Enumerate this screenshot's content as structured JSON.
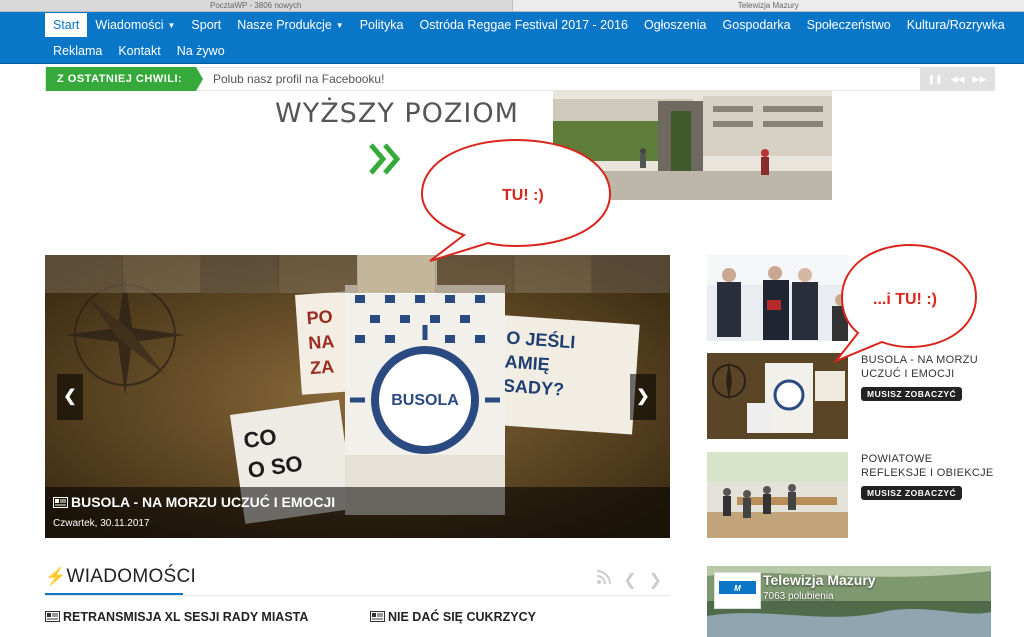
{
  "browser": {
    "tabs": [
      "PocztaWP - 3806 nowych",
      "Telewizja Mazury"
    ]
  },
  "nav": {
    "row1": [
      "Start",
      "Wiadomości",
      "Sport",
      "Nasze Produkcje",
      "Polityka",
      "Ostróda Reggae Festival 2017 - 2016",
      "Ogłoszenia",
      "Gospodarka",
      "Społeczeństwo",
      "Kultura/Rozrywka"
    ],
    "row2": [
      "Reklama",
      "Kontakt",
      "Na żywo"
    ],
    "active": "Start",
    "brand_color": "#0a76c8"
  },
  "ticker": {
    "label": "Z OSTATNIEJ CHWILI:",
    "text": "Polub nasz profil na Facebooku!",
    "label_color": "#36a93b"
  },
  "ad": {
    "headline": "WYŻSZY POZIOM"
  },
  "bubbles": {
    "first": "TU! :)",
    "second": "...i TU! :)",
    "color": "#d9261c"
  },
  "slider": {
    "caption_title": "BUSOLA - NA MORZU UCZUĆ I EMOCJI",
    "caption_date": "Czwartek, 30.11.2017"
  },
  "side": {
    "items": [
      {
        "title": "",
        "badge": ""
      },
      {
        "title": "BUSOLA - NA MORZU UCZUĆ I EMOCJI",
        "badge": "MUSISZ ZOBACZYĆ"
      },
      {
        "title": "POWIATOWE REFLEKSJE I OBIEKCJE",
        "badge": "MUSISZ ZOBACZYĆ"
      }
    ]
  },
  "section": {
    "title": "WIADOMOŚCI"
  },
  "articles": [
    "RETRANSMISJA XL SESJI RADY MIASTA",
    "NIE DAĆ SIĘ CUKRZYCY"
  ],
  "facebook": {
    "page_name": "Telewizja Mazury",
    "likes": "7063 polubienia"
  }
}
